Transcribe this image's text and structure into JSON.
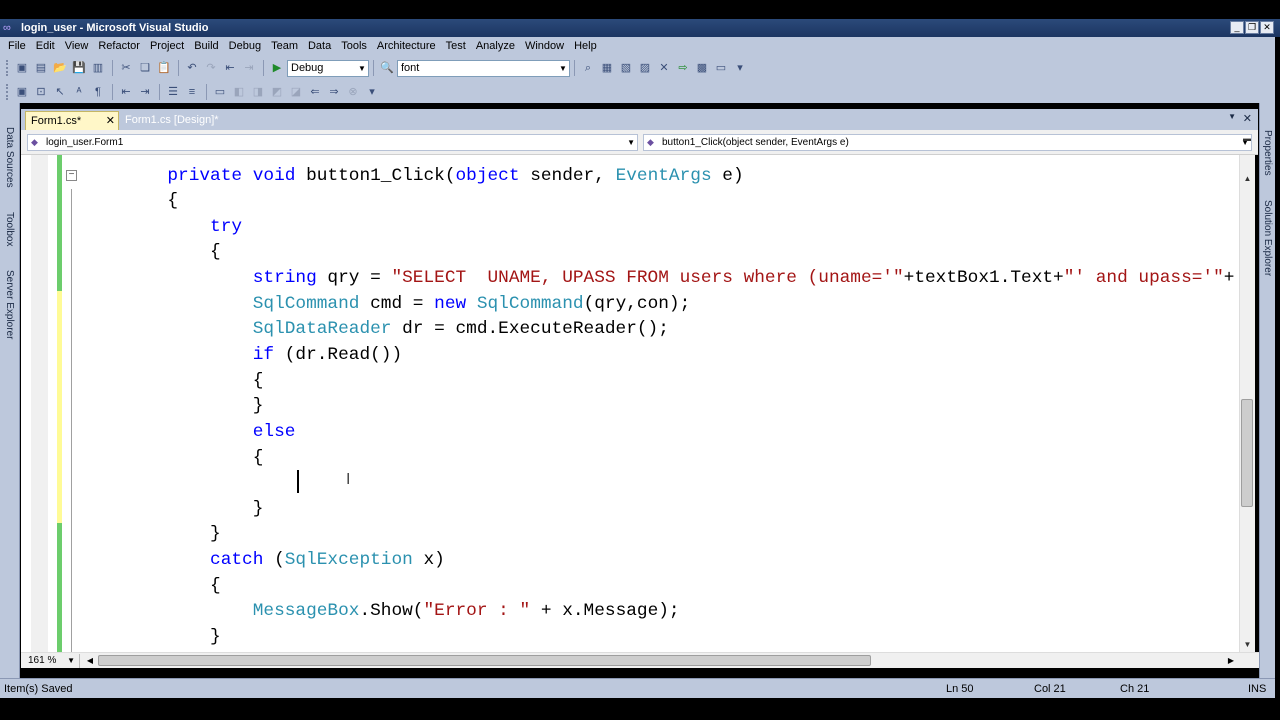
{
  "window": {
    "title": "login_user - Microsoft Visual Studio"
  },
  "menu": [
    "File",
    "Edit",
    "View",
    "Refactor",
    "Project",
    "Build",
    "Debug",
    "Team",
    "Data",
    "Tools",
    "Architecture",
    "Test",
    "Analyze",
    "Window",
    "Help"
  ],
  "toolbar": {
    "config_value": "Debug",
    "find_value": "font"
  },
  "left_dock": {
    "data_sources": "Data Sources",
    "toolbox": "Toolbox",
    "server_explorer": "Server Explorer"
  },
  "right_dock": {
    "properties": "Properties",
    "solution_explorer": "Solution Explorer"
  },
  "tabs": [
    {
      "label": "Form1.cs*",
      "active": true
    },
    {
      "label": "Form1.cs [Design]*",
      "active": false
    }
  ],
  "nav": {
    "type": "login_user.Form1",
    "member": "button1_Click(object sender, EventArgs e)"
  },
  "code": {
    "l1": {
      "k1": "private",
      "k2": "void",
      "t1": " button1_Click(",
      "k3": "object",
      "t2": " sender, ",
      "ty1": "EventArgs",
      "t3": " e)"
    },
    "l2": "{",
    "l3": "try",
    "l4": "{",
    "l5": {
      "k": "string",
      "t1": " qry = ",
      "s1": "\"SELECT  UNAME, UPASS FROM users where (uname='\"",
      "t2": "+textBox1.Text+",
      "s2": "\"' and upass='\"",
      "t3": "+"
    },
    "l6": {
      "ty1": "SqlCommand",
      "t1": " cmd = ",
      "k": "new",
      "t2": " ",
      "ty2": "SqlCommand",
      "t3": "(qry,con);"
    },
    "l7": {
      "ty1": "SqlDataReader",
      "t1": " dr = cmd.ExecuteReader();"
    },
    "l8": {
      "k": "if",
      "t1": " (dr.Read())"
    },
    "l9": "{",
    "l10": "}",
    "l11": "else",
    "l12": "{",
    "l14": "}",
    "l15": "}",
    "l16": {
      "k": "catch",
      "t1": " (",
      "ty": "SqlException",
      "t2": " x)"
    },
    "l17": "{",
    "l18": {
      "ty": "MessageBox",
      "t1": ".Show(",
      "s": "\"Error : \"",
      "t2": " + x.Message);"
    },
    "l19": "}"
  },
  "zoom": "161 %",
  "status": {
    "message": "Item(s) Saved",
    "ln": "Ln 50",
    "col": "Col 21",
    "ch": "Ch 21",
    "mode": "INS"
  },
  "colors": {
    "keyword": "#0000ff",
    "type": "#2b91af",
    "string": "#a31515",
    "title_bar": "#1c3562",
    "chrome": "#bdc8dc"
  }
}
